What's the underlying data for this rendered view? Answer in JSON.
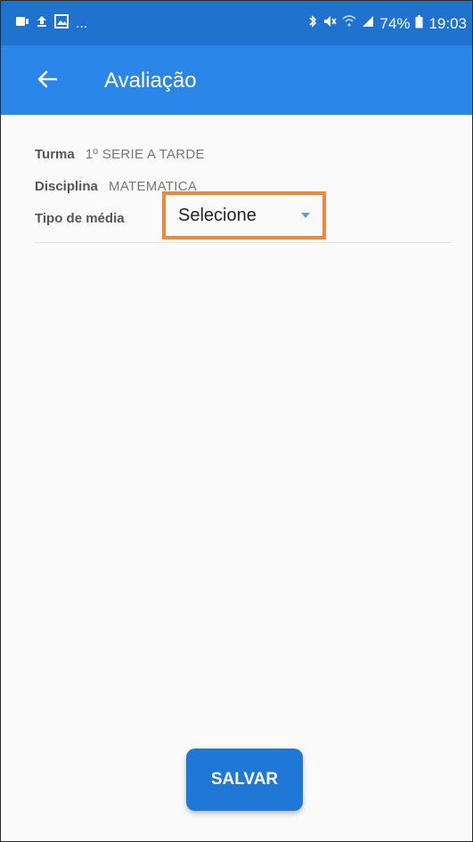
{
  "status_bar": {
    "left_icons": [
      "notification-icon",
      "upload-icon",
      "image-icon"
    ],
    "overflow": "...",
    "right_icons": [
      "bluetooth-icon",
      "mute-icon",
      "wifi-icon",
      "signal-icon"
    ],
    "battery": "74%",
    "time": "19:03"
  },
  "app_bar": {
    "title": "Avaliação",
    "back_icon": "arrow-left-icon",
    "color": "#2a86e8"
  },
  "form": {
    "turma_label": "Turma",
    "turma_value": "1º SERIE A TARDE",
    "disciplina_label": "Disciplina",
    "disciplina_value": "MATEMATICA",
    "tipo_label": "Tipo de média",
    "tipo_select": "Selecione"
  },
  "highlight_color": "#f0873a",
  "actions": {
    "save_label": "SALVAR"
  }
}
